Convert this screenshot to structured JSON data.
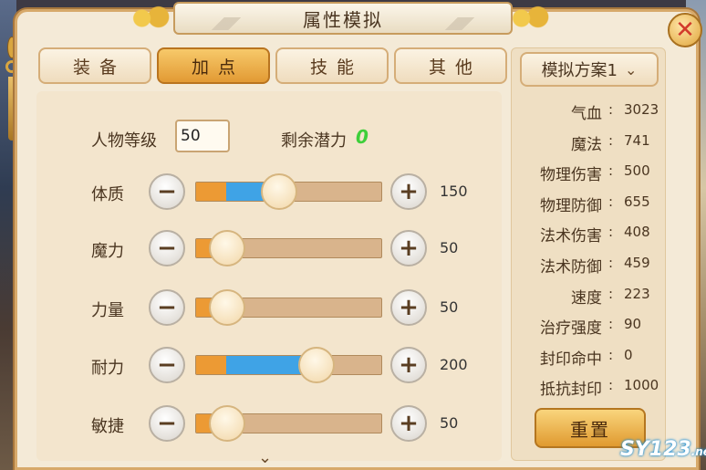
{
  "window": {
    "title": "属性模拟",
    "close_glyph": "✕"
  },
  "tabs": [
    {
      "label": "装备",
      "active": false
    },
    {
      "label": "加点",
      "active": true
    },
    {
      "label": "技能",
      "active": false
    },
    {
      "label": "其他",
      "active": false
    }
  ],
  "level": {
    "label": "人物等级",
    "value": "50"
  },
  "potential": {
    "label": "剩余潜力",
    "value": "0"
  },
  "attributes": [
    {
      "label": "体质",
      "value": "150",
      "level": 0.44,
      "base_level": 0.16
    },
    {
      "label": "魔力",
      "value": "50",
      "level": 0.16,
      "base_level": 0.16
    },
    {
      "label": "力量",
      "value": "50",
      "level": 0.16,
      "base_level": 0.16
    },
    {
      "label": "耐力",
      "value": "200",
      "level": 0.64,
      "base_level": 0.16
    },
    {
      "label": "敏捷",
      "value": "50",
      "level": 0.16,
      "base_level": 0.16
    }
  ],
  "controls": {
    "minus": "−",
    "plus": "+",
    "scroll_down": "⌄"
  },
  "plan": {
    "label": "模拟方案1",
    "chevron": "⌄"
  },
  "stats": [
    {
      "name": "气血",
      "value": "3023"
    },
    {
      "name": "魔法",
      "value": "741"
    },
    {
      "name": "物理伤害",
      "value": "500"
    },
    {
      "name": "物理防御",
      "value": "655"
    },
    {
      "name": "法术伤害",
      "value": "408"
    },
    {
      "name": "法术防御",
      "value": "459"
    },
    {
      "name": "速度",
      "value": "223"
    },
    {
      "name": "治疗强度",
      "value": "90"
    },
    {
      "name": "封印命中",
      "value": "0"
    },
    {
      "name": "抵抗封印",
      "value": "1000"
    }
  ],
  "stat_colon": ":",
  "reset_label": "重置",
  "watermark": {
    "main": "SY123",
    "suffix": ".net"
  },
  "colors": {
    "accent": "#e29a34",
    "base_fill": "#ec9a34",
    "added_fill": "#3fa3e6",
    "potential": "#3ecf3a",
    "close": "#d23a2b"
  }
}
